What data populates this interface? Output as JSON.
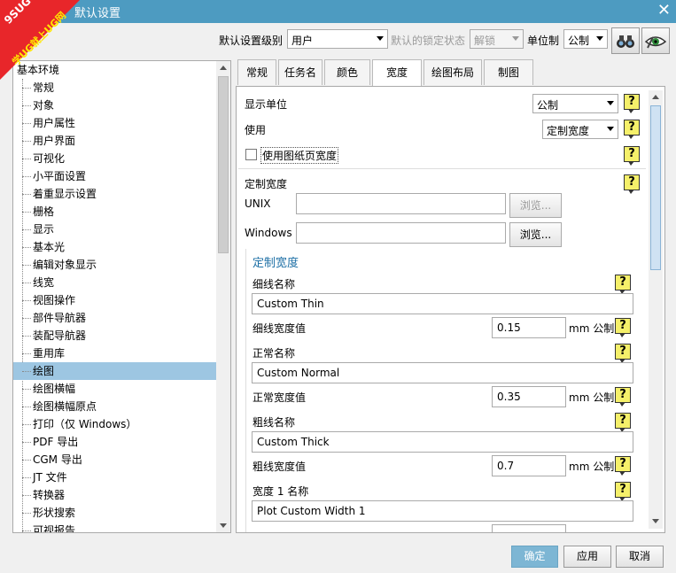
{
  "window": {
    "title": "默认设置"
  },
  "watermark": {
    "line1": "9SUG",
    "line2": "学UG就上UG网"
  },
  "toolbar": {
    "level_label": "默认设置级别",
    "level_value": "用户",
    "lock_label": "默认的锁定状态",
    "lock_value": "解锁",
    "unit_label": "单位制",
    "unit_value": "公制"
  },
  "tree": {
    "root": "基本环境",
    "items": [
      "常规",
      "对象",
      "用户属性",
      "用户界面",
      "可视化",
      "小平面设置",
      "着重显示设置",
      "栅格",
      "显示",
      "基本光",
      "编辑对象显示",
      "线宽",
      "视图操作",
      "部件导航器",
      "装配导航器",
      "重用库",
      "绘图",
      "绘图横幅",
      "绘图横幅原点",
      "打印（仅 Windows）",
      "PDF 导出",
      "CGM 导出",
      "JT 文件",
      "转换器",
      "形状搜索",
      "可视报告"
    ],
    "selected": "绘图"
  },
  "tabs": [
    "常规",
    "任务名",
    "颜色",
    "宽度",
    "绘图布局",
    "制图"
  ],
  "active_tab": "宽度",
  "panel": {
    "display_unit_label": "显示单位",
    "display_unit_value": "公制",
    "use_label": "使用",
    "use_value": "定制宽度",
    "use_sheet_width_label": "使用图纸页宽度",
    "custom_width_label": "定制宽度",
    "unix_label": "UNIX",
    "unix_value": "",
    "windows_label": "Windows",
    "windows_value": "",
    "browse_label": "浏览...",
    "group_title": "定制宽度",
    "thin_name_label": "细线名称",
    "thin_name_value": "Custom Thin",
    "thin_width_label": "细线宽度值",
    "thin_width_value": "0.15",
    "normal_name_label": "正常名称",
    "normal_name_value": "Custom Normal",
    "normal_width_label": "正常宽度值",
    "normal_width_value": "0.35",
    "thick_name_label": "粗线名称",
    "thick_name_value": "Custom Thick",
    "thick_width_label": "粗线宽度值",
    "thick_width_value": "0.7",
    "unit_suffix": "mm 公制",
    "width1_name_label": "宽度 1 名称",
    "width1_name_value": "Plot Custom Width 1",
    "help_glyph": "?"
  },
  "footer": {
    "ok": "确定",
    "apply": "应用",
    "cancel": "取消"
  },
  "colors": {
    "titlebar": "#4d9bc1",
    "selected": "#9dc6e2",
    "primary_button": "#7db6d4",
    "group_title": "#1d6fa5"
  },
  "icons": [
    "close-icon",
    "help-icon",
    "binoculars-icon",
    "eye-icon"
  ]
}
